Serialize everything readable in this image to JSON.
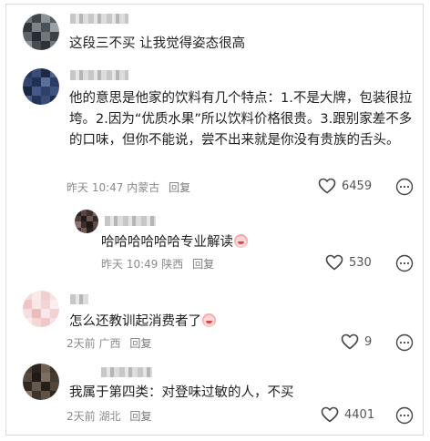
{
  "comments": [
    {
      "text": "这段三不买 让我觉得姿态很高"
    },
    {
      "text": "他的意思是他家的饮料有几个特点：1.不是大牌，包装很拉垮。2.因为“优质水果”所以饮料价格很贵。3.跟别家差不多的口味，但你不能说，尝不出来就是你没有贵族的舌头。",
      "time": "昨天 10:47",
      "location": "内蒙古",
      "reply": "回复",
      "likes": "6459"
    },
    {
      "text": "哈哈哈哈哈哈专业解读",
      "time": "昨天 10:49",
      "location": "陕西",
      "reply": "回复",
      "likes": "530"
    },
    {
      "text": "怎么还教训起消费者了",
      "time": "2天前",
      "location": "广西",
      "reply": "回复",
      "likes": "9"
    },
    {
      "text": "我属于第四类：对登味过敏的人，不买",
      "time": "2天前",
      "location": "湖北",
      "reply": "回复",
      "likes": "4401"
    }
  ],
  "icons": {
    "like": "heart-outline-icon",
    "more": "more-dots-icon",
    "emoji": "laughing-emoji-icon"
  },
  "colors": {
    "text": "#202020",
    "meta": "#8a8a8a",
    "border": "#d9d9d9"
  }
}
